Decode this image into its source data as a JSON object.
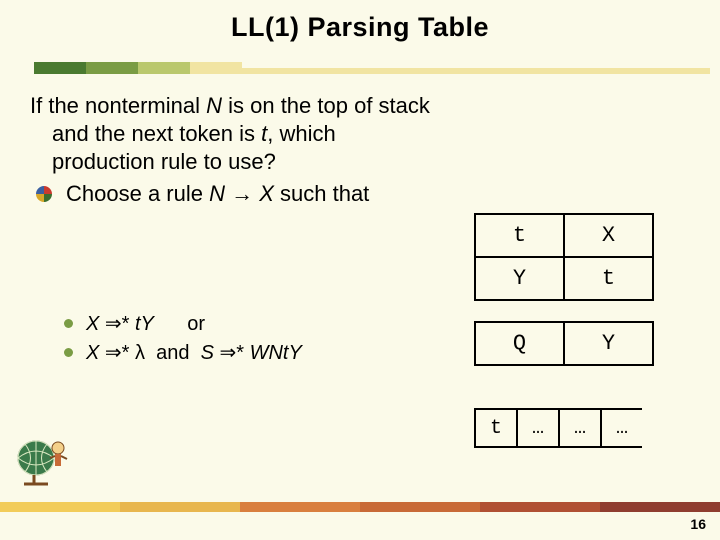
{
  "title": "LL(1) Parsing Table",
  "intro": {
    "line1": "If the nonterminal ",
    "N": "N",
    "line2": " is on the top of stack and the next token is ",
    "t": "t",
    "line3": ", which production rule to use?"
  },
  "choose": {
    "pre": "Choose a rule ",
    "N": "N",
    "arrow": " → ",
    "X": "X",
    "post": " such that"
  },
  "sub1": {
    "X": "X",
    "arr": " ⇒* ",
    "tY": "tY",
    "or": "      or"
  },
  "sub2": {
    "X": "X",
    "arr": " ⇒* ",
    "lam": "λ",
    "and": "  and  ",
    "S": "S",
    "arr2": " ⇒* ",
    "WNtY": "WNtY"
  },
  "stack": {
    "r1c1": "t",
    "r1c2": "X",
    "r2c1": "Y",
    "r2c2": "t",
    "r3c1": "Q",
    "r3c2": "Y"
  },
  "tape": {
    "c0": "t",
    "c1": "…",
    "c2": "…",
    "c3": "…"
  },
  "page": "16"
}
